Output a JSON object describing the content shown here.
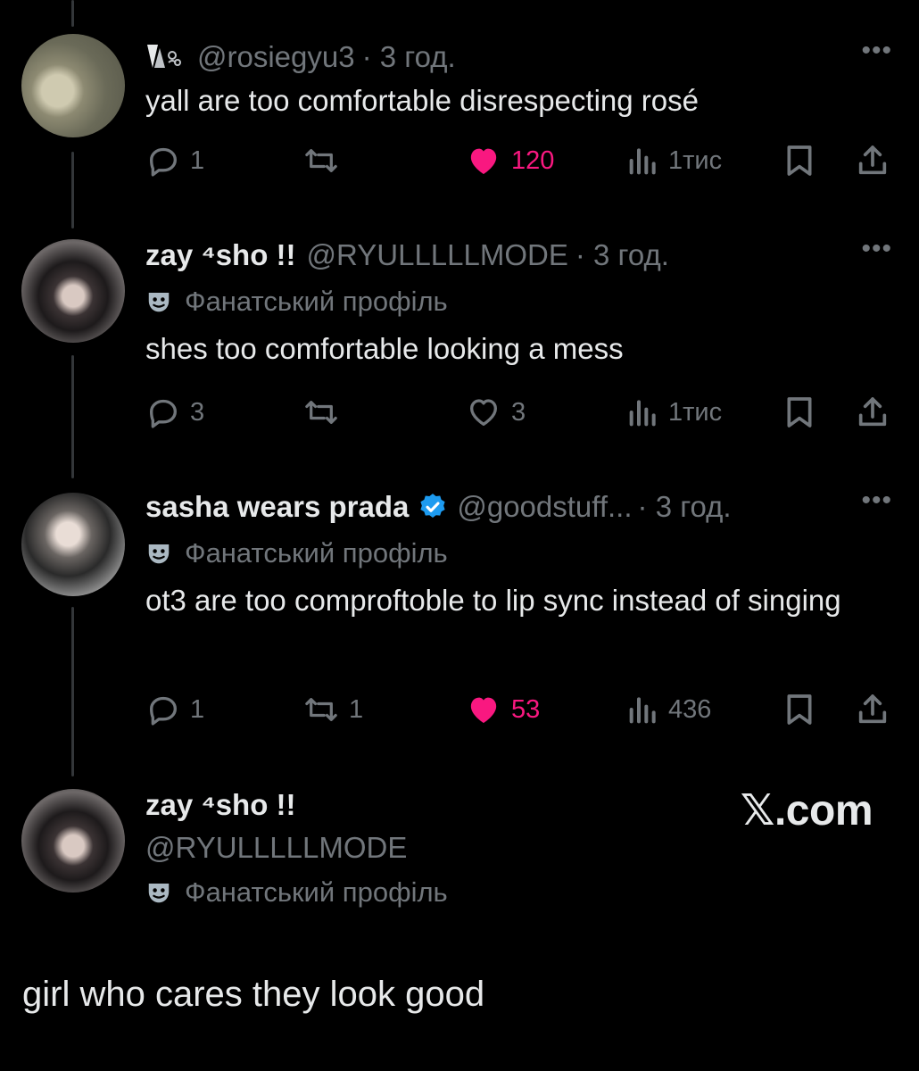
{
  "tweets": [
    {
      "handle": "@rosiegyu3",
      "time": "· 3 год.",
      "text": "yall are too comfortable disrespecting rosé",
      "replies": "1",
      "retweets": "",
      "likes": "120",
      "views": "1тис"
    },
    {
      "name": "zay ⁴sho !!",
      "handle": "@RYULLLLLMODE",
      "time": "· 3 год.",
      "fan_label": "Фанатський профіль",
      "text": "shes too comfortable looking a mess",
      "replies": "3",
      "retweets": "",
      "likes": "3",
      "views": "1тис"
    },
    {
      "name": "sasha wears prada",
      "handle": "@goodstuff...",
      "time": "· 3 год.",
      "fan_label": "Фанатський профіль",
      "text": "ot3 are too comproftoble to lip sync instead of singing",
      "replies": "1",
      "retweets": "1",
      "likes": "53",
      "views": "436"
    },
    {
      "name": "zay ⁴sho !!",
      "handle": "@RYULLLLLMODE",
      "fan_label": "Фанатський профіль"
    }
  ],
  "more_label": "•••",
  "watermark": "𝕏.com",
  "final_text": "girl who cares they look good",
  "colors": {
    "like": "#f91880",
    "verified": "#1d9bf0",
    "muted": "#71767b"
  },
  "icons": [
    "reply-icon",
    "retweet-icon",
    "heart-icon",
    "views-icon",
    "bookmark-icon",
    "share-icon",
    "verified-badge-icon",
    "mask-icon",
    "more-icon"
  ]
}
